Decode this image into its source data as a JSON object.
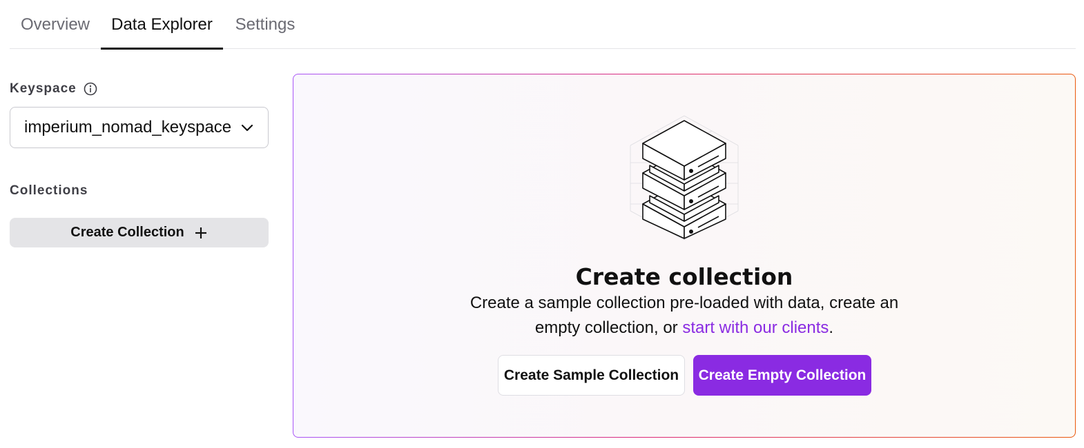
{
  "tabs": [
    {
      "label": "Overview",
      "active": false
    },
    {
      "label": "Data Explorer",
      "active": true
    },
    {
      "label": "Settings",
      "active": false
    }
  ],
  "sidebar": {
    "keyspace_label": "Keyspace",
    "keyspace_info_icon": "info-icon",
    "keyspace_value": "imperium_nomad_keyspace",
    "keyspace_chevron_icon": "chevron-down-icon",
    "collections_label": "Collections",
    "create_collection_label": "Create Collection",
    "create_collection_icon": "plus-icon"
  },
  "main": {
    "illustration_icon": "server-stack-icon",
    "title": "Create collection",
    "description_prefix": "Create a sample collection pre-loaded with data, create an empty collection, or ",
    "description_link": "start with our clients",
    "description_suffix": ".",
    "sample_button_label": "Create Sample Collection",
    "empty_button_label": "Create Empty Collection"
  },
  "colors": {
    "accent": "#8a2be2",
    "border_gradient_start": "#a855f7",
    "border_gradient_end": "#ea580c",
    "secondary_button_bg": "#e4e4e7"
  }
}
